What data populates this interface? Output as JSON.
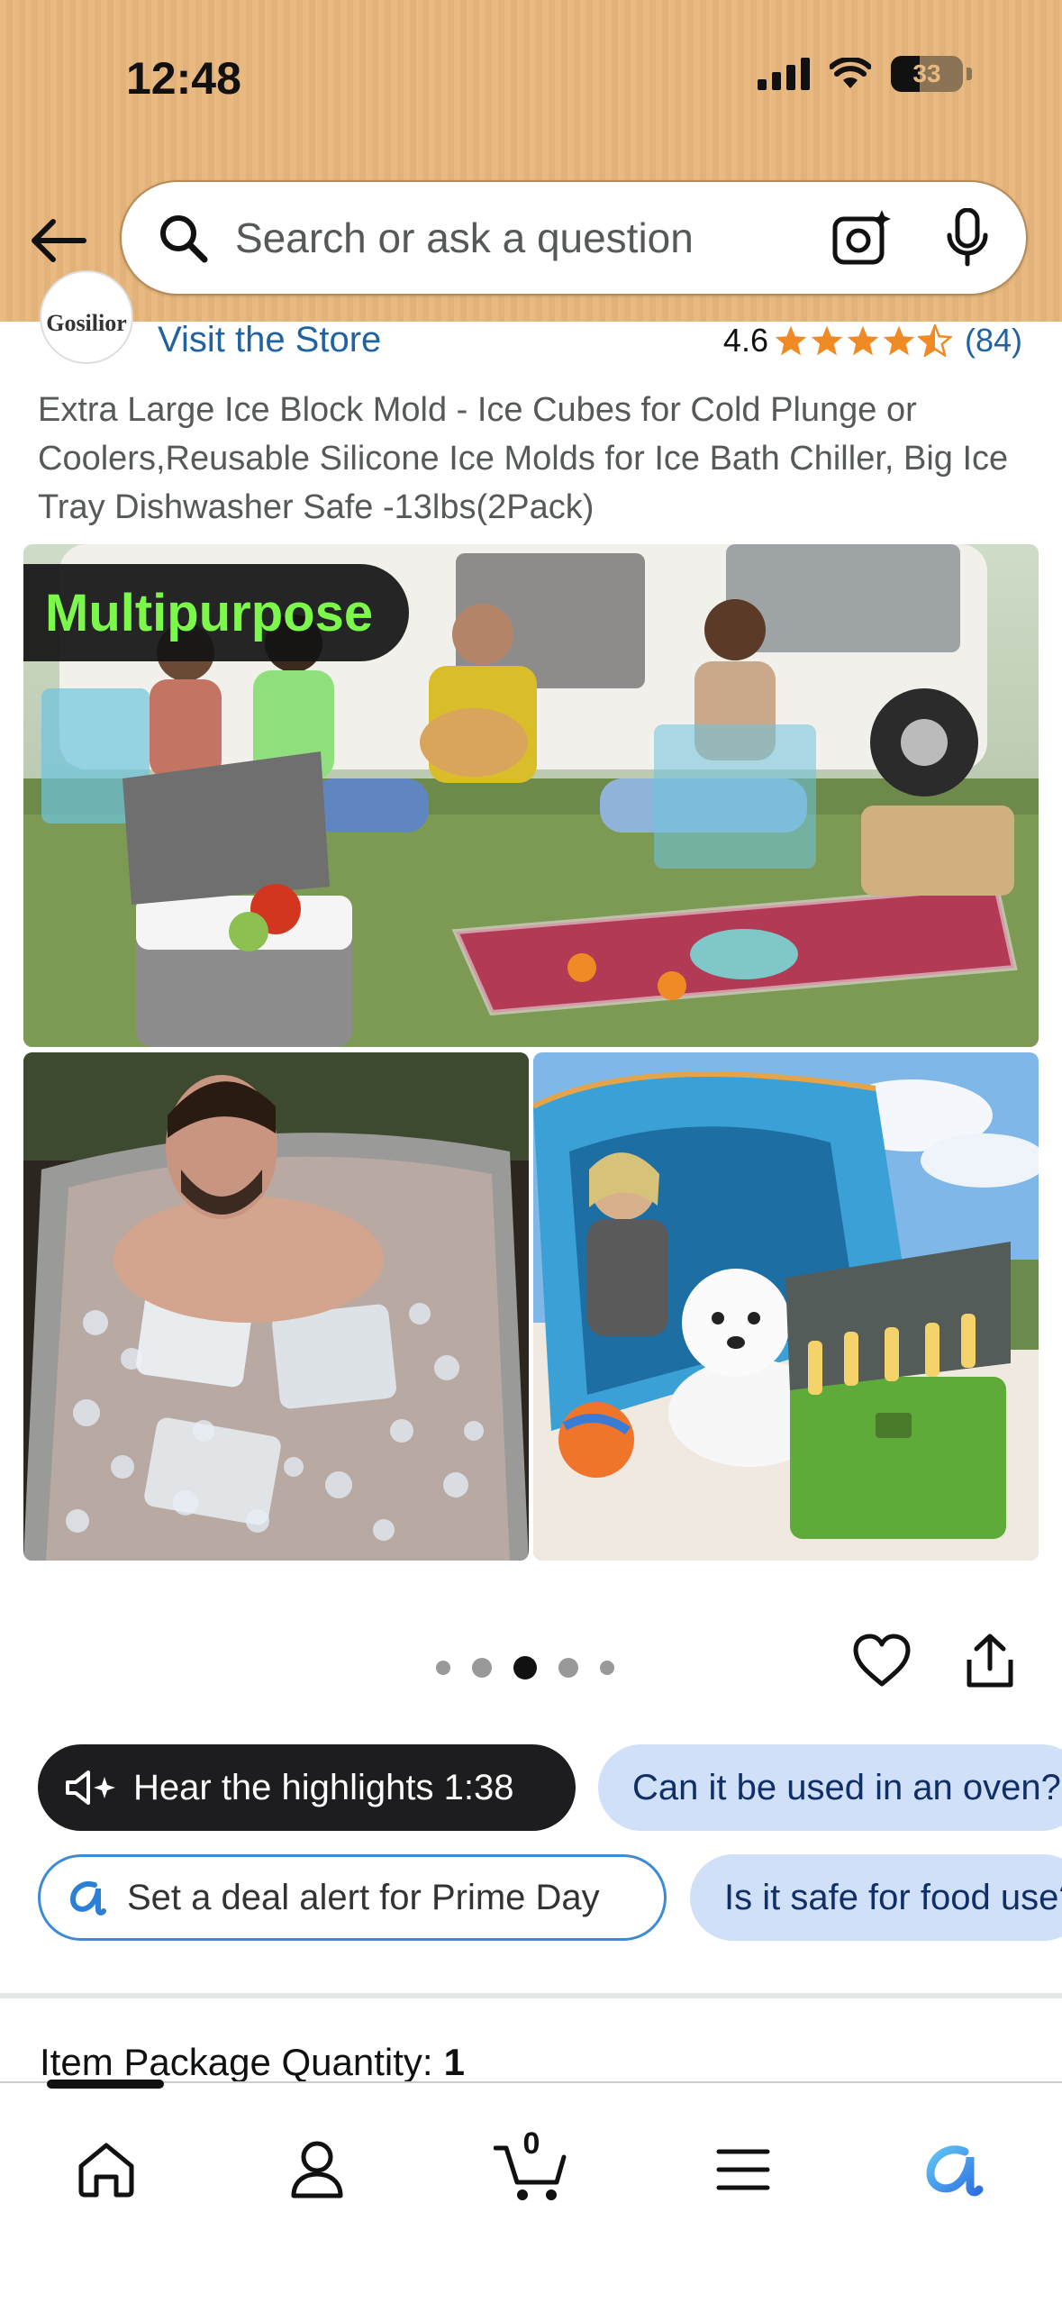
{
  "status_bar": {
    "time": "12:48",
    "battery": "33"
  },
  "search": {
    "placeholder": "Search or ask a question"
  },
  "store": {
    "logo_text": "Gosilior",
    "link_label": "Visit the Store"
  },
  "rating": {
    "value": "4.6",
    "count": "(84)",
    "stars": 4.5
  },
  "product": {
    "title": "Extra Large Ice Block Mold - Ice Cubes for Cold Plunge or Coolers,Reusable Silicone Ice Molds for Ice Bath Chiller, Big Ice Tray Dishwasher Safe -13lbs(2Pack)"
  },
  "images": {
    "main_badge": "Multipurpose",
    "carousel": {
      "count": 5,
      "active_index": 2
    }
  },
  "chips": {
    "highlights": "Hear the highlights 1:38",
    "question_oven": "Can it be used in an oven?",
    "deal_alert": "Set a deal alert for Prime Day",
    "question_food": "Is it safe for food use?"
  },
  "quantity": {
    "label": "Item Package Quantity:",
    "value": "1"
  },
  "nav": {
    "cart_count": "0"
  },
  "colors": {
    "header_bg": "#e8ba82",
    "link": "#2162a1",
    "star": "#f08a24",
    "chip_blue": "#cfe0f8",
    "chip_dark": "#1d1d1f",
    "badge_green": "#7cf84a"
  },
  "icons": [
    "back-arrow-icon",
    "search-icon",
    "camera-icon",
    "microphone-icon",
    "star-icon",
    "heart-icon",
    "share-icon",
    "speaker-icon",
    "rufus-icon",
    "home-icon",
    "user-icon",
    "cart-icon",
    "menu-icon"
  ]
}
